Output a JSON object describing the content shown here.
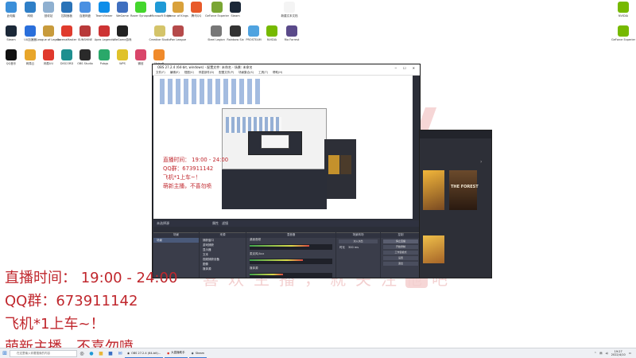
{
  "desktop": {
    "watermark": "喜欢主播，就关注他吧",
    "icons_row1": [
      {
        "label": "此电脑",
        "icon": "computer-icon",
        "color": "#3b8fd9"
      },
      {
        "label": "网络",
        "icon": "network-icon",
        "color": "#2f7fc7"
      },
      {
        "label": "回收站",
        "icon": "recycle-bin-icon",
        "color": "#8fb0d0"
      },
      {
        "label": "控制面板",
        "icon": "control-panel-icon",
        "color": "#2a73b8"
      },
      {
        "label": "百度网盘",
        "icon": "cloud-drive-icon",
        "color": "#4a90e2"
      },
      {
        "label": "TeamViewer",
        "icon": "teamviewer-icon",
        "color": "#0e8ee9"
      },
      {
        "label": "WeGame",
        "icon": "wegame-icon",
        "color": "#3f6fbf"
      },
      {
        "label": "Razer Synapse",
        "icon": "razer-icon",
        "color": "#44d62c"
      },
      {
        "label": "Microsoft Edge",
        "icon": "edge-icon",
        "color": "#1f9ad6"
      },
      {
        "label": "Honor of Kings",
        "icon": "game-icon",
        "color": "#d9a13b"
      },
      {
        "label": "腾讯QQ",
        "icon": "qq-icon",
        "color": "#e85a2a"
      },
      {
        "label": "GeForce Experience",
        "icon": "geforce-icon",
        "color": "#7aa634"
      },
      {
        "label": "Steam",
        "icon": "steam-icon",
        "color": "#1b2838"
      }
    ],
    "icons_row2": [
      {
        "label": "Steam",
        "icon": "steam-icon",
        "color": "#1b2838"
      },
      {
        "label": "UU加速器",
        "icon": "accelerator-icon",
        "color": "#2a6fdb"
      },
      {
        "label": "League of Legends",
        "icon": "lol-icon",
        "color": "#c89b3c"
      },
      {
        "label": "GarenaMaster",
        "icon": "garena-icon",
        "color": "#e03b2d"
      },
      {
        "label": "SUNSHINE",
        "icon": "sunshine-icon",
        "color": "#b83a3a"
      },
      {
        "label": "Apex Legends",
        "icon": "apex-icon",
        "color": "#cd3333"
      },
      {
        "label": "WeGame游戏",
        "icon": "mw-icon",
        "color": "#222222"
      },
      {
        "label": "Creative Studio",
        "icon": "creative-icon",
        "color": "#d4c46a"
      },
      {
        "label": "Pan League",
        "icon": "pan-icon",
        "color": "#b54a4a"
      },
      {
        "label": "Steel Legion",
        "icon": "anchor-icon",
        "color": "#777777"
      },
      {
        "label": "Rainbow Six",
        "icon": "r6-icon",
        "color": "#333333"
      },
      {
        "label": "PROSTEAM",
        "icon": "cat-icon",
        "color": "#4fa3e0"
      },
      {
        "label": "NVIDIA",
        "icon": "nvidia-icon",
        "color": "#76b900"
      },
      {
        "label": "Rio Forrest",
        "icon": "skull-icon",
        "color": "#5a4a8a"
      }
    ],
    "icons_row3": [
      {
        "label": "QQ音乐",
        "icon": "penguin-icon",
        "color": "#111111"
      },
      {
        "label": "网易云",
        "icon": "netease-icon",
        "color": "#e8a62a"
      },
      {
        "label": "网易UU",
        "icon": "uu-icon",
        "color": "#e0392d"
      },
      {
        "label": "DISCORD",
        "icon": "discord-icon",
        "color": "#1f8f8f"
      },
      {
        "label": "OBS Studio",
        "icon": "obs-icon",
        "color": "#2a2a2a"
      },
      {
        "label": "Pubgs",
        "icon": "pubg-icon",
        "color": "#2aa86a"
      },
      {
        "label": "WPS",
        "icon": "wps-icon",
        "color": "#e0c22a"
      },
      {
        "label": "微信",
        "icon": "chat-icon",
        "color": "#d9466a"
      },
      {
        "label": "Ubisoft",
        "icon": "ubisoft-icon",
        "color": "#f08a2a"
      }
    ],
    "right_icons": [
      {
        "label": "NVIDIA",
        "icon": "nvidia-icon",
        "color": "#76b900"
      },
      {
        "label": "GeForce Experience",
        "icon": "geforce-icon",
        "color": "#76b900"
      }
    ],
    "file_icon": {
      "label": "新建文本文档",
      "icon": "file-icon"
    }
  },
  "obs": {
    "title": "OBS 27.2.4 (64-bit, windows) - 配置文件: 未命名 - 场景: 未命名",
    "menus": [
      "文件(F)",
      "编辑(E)",
      "视图(V)",
      "停靠部件(D)",
      "配置文件(P)",
      "场景集合(S)",
      "工具(T)",
      "帮助(H)"
    ],
    "window_controls": {
      "minimize": "─",
      "maximize": "☐",
      "close": "✕"
    },
    "preview_bar_label": "未选择源",
    "properties_btn": "属性",
    "filters_btn": "滤镜",
    "docks": {
      "scenes": {
        "title": "场景",
        "items": [
          "场景"
        ]
      },
      "sources": {
        "title": "来源",
        "items": [
          "捕获窗口",
          "游戏捕获",
          "显示器",
          "文本",
          "视频捕获设备",
          "图像",
          "媒体源"
        ]
      },
      "mixer": {
        "title": "混音器",
        "tracks": [
          {
            "name": "桌面音频",
            "db": "0.0 dB",
            "level": 0.72
          },
          {
            "name": "麦克风/Aux",
            "db": "0.0 dB",
            "level": 0.64
          },
          {
            "name": "媒体源",
            "db": "0.0 dB",
            "level": 0.4
          }
        ]
      },
      "transitions": {
        "title": "场景转场",
        "value": "淡入淡出",
        "duration_label": "时长",
        "duration": "300 ms"
      },
      "controls": {
        "title": "控制",
        "buttons": [
          "停止直播",
          "开始录制",
          "工作室模式",
          "设置",
          "退出"
        ]
      }
    }
  },
  "overlay": {
    "lines": [
      "直播时间： 19:00 - 24:00",
      "QQ群：673911142",
      "飞机*1上车~！",
      "萌新主播，不喜勿喷"
    ]
  },
  "preview_overlay": {
    "lines": [
      "直播时间： 19:00 - 24:00",
      "QQ群：673911142",
      "飞机*1上车~！",
      "萌新主播，不喜勿喷"
    ]
  },
  "game": {
    "title": "THE FOREST"
  },
  "taskbar": {
    "search_placeholder": "在这里输入你要搜索的内容",
    "apps": [
      {
        "label": "OBS 27.2.4 (64-bit)...",
        "icon": "obs-icon"
      },
      {
        "label": "大直播助手",
        "icon": "live-icon"
      },
      {
        "label": "Steam",
        "icon": "steam-icon"
      }
    ],
    "time": "19:27",
    "date": "2022/4/10"
  }
}
